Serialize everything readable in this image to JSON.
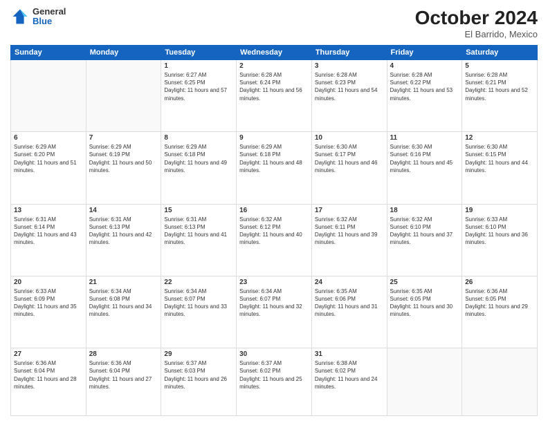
{
  "header": {
    "logo": {
      "general": "General",
      "blue": "Blue"
    },
    "title": "October 2024",
    "location": "El Barrido, Mexico"
  },
  "weekdays": [
    "Sunday",
    "Monday",
    "Tuesday",
    "Wednesday",
    "Thursday",
    "Friday",
    "Saturday"
  ],
  "weeks": [
    [
      {
        "day": "",
        "info": ""
      },
      {
        "day": "",
        "info": ""
      },
      {
        "day": "1",
        "info": "Sunrise: 6:27 AM\nSunset: 6:25 PM\nDaylight: 11 hours and 57 minutes."
      },
      {
        "day": "2",
        "info": "Sunrise: 6:28 AM\nSunset: 6:24 PM\nDaylight: 11 hours and 56 minutes."
      },
      {
        "day": "3",
        "info": "Sunrise: 6:28 AM\nSunset: 6:23 PM\nDaylight: 11 hours and 54 minutes."
      },
      {
        "day": "4",
        "info": "Sunrise: 6:28 AM\nSunset: 6:22 PM\nDaylight: 11 hours and 53 minutes."
      },
      {
        "day": "5",
        "info": "Sunrise: 6:28 AM\nSunset: 6:21 PM\nDaylight: 11 hours and 52 minutes."
      }
    ],
    [
      {
        "day": "6",
        "info": "Sunrise: 6:29 AM\nSunset: 6:20 PM\nDaylight: 11 hours and 51 minutes."
      },
      {
        "day": "7",
        "info": "Sunrise: 6:29 AM\nSunset: 6:19 PM\nDaylight: 11 hours and 50 minutes."
      },
      {
        "day": "8",
        "info": "Sunrise: 6:29 AM\nSunset: 6:18 PM\nDaylight: 11 hours and 49 minutes."
      },
      {
        "day": "9",
        "info": "Sunrise: 6:29 AM\nSunset: 6:18 PM\nDaylight: 11 hours and 48 minutes."
      },
      {
        "day": "10",
        "info": "Sunrise: 6:30 AM\nSunset: 6:17 PM\nDaylight: 11 hours and 46 minutes."
      },
      {
        "day": "11",
        "info": "Sunrise: 6:30 AM\nSunset: 6:16 PM\nDaylight: 11 hours and 45 minutes."
      },
      {
        "day": "12",
        "info": "Sunrise: 6:30 AM\nSunset: 6:15 PM\nDaylight: 11 hours and 44 minutes."
      }
    ],
    [
      {
        "day": "13",
        "info": "Sunrise: 6:31 AM\nSunset: 6:14 PM\nDaylight: 11 hours and 43 minutes."
      },
      {
        "day": "14",
        "info": "Sunrise: 6:31 AM\nSunset: 6:13 PM\nDaylight: 11 hours and 42 minutes."
      },
      {
        "day": "15",
        "info": "Sunrise: 6:31 AM\nSunset: 6:13 PM\nDaylight: 11 hours and 41 minutes."
      },
      {
        "day": "16",
        "info": "Sunrise: 6:32 AM\nSunset: 6:12 PM\nDaylight: 11 hours and 40 minutes."
      },
      {
        "day": "17",
        "info": "Sunrise: 6:32 AM\nSunset: 6:11 PM\nDaylight: 11 hours and 39 minutes."
      },
      {
        "day": "18",
        "info": "Sunrise: 6:32 AM\nSunset: 6:10 PM\nDaylight: 11 hours and 37 minutes."
      },
      {
        "day": "19",
        "info": "Sunrise: 6:33 AM\nSunset: 6:10 PM\nDaylight: 11 hours and 36 minutes."
      }
    ],
    [
      {
        "day": "20",
        "info": "Sunrise: 6:33 AM\nSunset: 6:09 PM\nDaylight: 11 hours and 35 minutes."
      },
      {
        "day": "21",
        "info": "Sunrise: 6:34 AM\nSunset: 6:08 PM\nDaylight: 11 hours and 34 minutes."
      },
      {
        "day": "22",
        "info": "Sunrise: 6:34 AM\nSunset: 6:07 PM\nDaylight: 11 hours and 33 minutes."
      },
      {
        "day": "23",
        "info": "Sunrise: 6:34 AM\nSunset: 6:07 PM\nDaylight: 11 hours and 32 minutes."
      },
      {
        "day": "24",
        "info": "Sunrise: 6:35 AM\nSunset: 6:06 PM\nDaylight: 11 hours and 31 minutes."
      },
      {
        "day": "25",
        "info": "Sunrise: 6:35 AM\nSunset: 6:05 PM\nDaylight: 11 hours and 30 minutes."
      },
      {
        "day": "26",
        "info": "Sunrise: 6:36 AM\nSunset: 6:05 PM\nDaylight: 11 hours and 29 minutes."
      }
    ],
    [
      {
        "day": "27",
        "info": "Sunrise: 6:36 AM\nSunset: 6:04 PM\nDaylight: 11 hours and 28 minutes."
      },
      {
        "day": "28",
        "info": "Sunrise: 6:36 AM\nSunset: 6:04 PM\nDaylight: 11 hours and 27 minutes."
      },
      {
        "day": "29",
        "info": "Sunrise: 6:37 AM\nSunset: 6:03 PM\nDaylight: 11 hours and 26 minutes."
      },
      {
        "day": "30",
        "info": "Sunrise: 6:37 AM\nSunset: 6:02 PM\nDaylight: 11 hours and 25 minutes."
      },
      {
        "day": "31",
        "info": "Sunrise: 6:38 AM\nSunset: 6:02 PM\nDaylight: 11 hours and 24 minutes."
      },
      {
        "day": "",
        "info": ""
      },
      {
        "day": "",
        "info": ""
      }
    ]
  ]
}
